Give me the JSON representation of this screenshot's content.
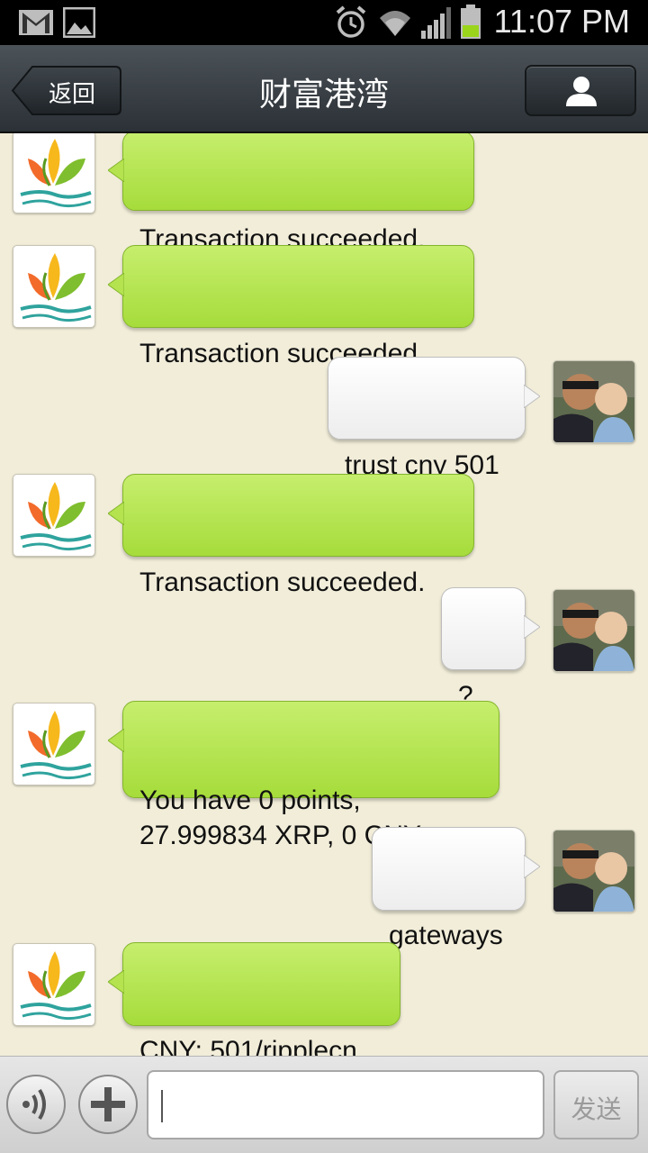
{
  "status_bar": {
    "time": "11:07 PM",
    "icons": [
      "gmail-icon",
      "gallery-icon",
      "alarm-icon",
      "wifi-icon",
      "signal-icon",
      "battery-icon"
    ]
  },
  "header": {
    "back_label": "返回",
    "title": "财富港湾",
    "profile_icon": "person-icon"
  },
  "messages": [
    {
      "side": "in",
      "text": "Transaction succeeded."
    },
    {
      "side": "in",
      "text": "Transaction succeeded."
    },
    {
      "side": "out",
      "text": "trust cny 501"
    },
    {
      "side": "in",
      "text": "Transaction succeeded."
    },
    {
      "side": "out",
      "text": "?"
    },
    {
      "side": "in",
      "text": "You have 0 points,\n27.999834 XRP, 0 CNY"
    },
    {
      "side": "out",
      "text": "gateways"
    },
    {
      "side": "in",
      "text": "CNY: 501/ripplecn"
    }
  ],
  "input_bar": {
    "voice_icon": "voice-icon",
    "add_icon": "plus-icon",
    "text_value": "",
    "send_label": "发送"
  },
  "colors": {
    "chat_background": "#f1edd9",
    "incoming_bubble": "#b4e34f",
    "outgoing_bubble": "#f5f5f5",
    "title_bar": "#353b40"
  }
}
